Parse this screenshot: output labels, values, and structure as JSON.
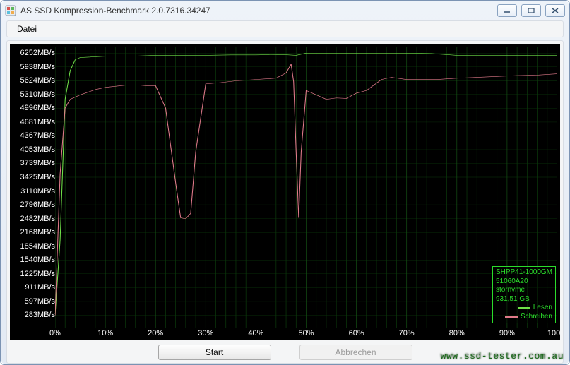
{
  "window": {
    "title": "AS SSD Kompression-Benchmark 2.0.7316.34247",
    "minimize_tip": "Minimize",
    "maximize_tip": "Maximize",
    "close_tip": "Close"
  },
  "menu": {
    "file": "Datei"
  },
  "buttons": {
    "start": "Start",
    "abort": "Abbrechen"
  },
  "legend": {
    "device_model": "SHPP41-1000GM",
    "firmware": "51060A20",
    "driver": "stornvme",
    "capacity": "931,51 GB",
    "read_label": "Lesen",
    "write_label": "Schreiben"
  },
  "watermark": "www.ssd-tester.com.au",
  "chart_data": {
    "type": "line",
    "title": "",
    "xlabel": "",
    "ylabel": "",
    "x_unit": "%",
    "y_unit": "MB/s",
    "xlim": [
      0,
      100
    ],
    "ylim": [
      0,
      6400
    ],
    "y_ticks": [
      283,
      597,
      911,
      1225,
      1540,
      1854,
      2168,
      2482,
      2796,
      3110,
      3425,
      3739,
      4053,
      4367,
      4681,
      4996,
      5310,
      5624,
      5938,
      6252
    ],
    "y_tick_labels": [
      "283MB/s",
      "597MB/s",
      "911MB/s",
      "1225MB/s",
      "1540MB/s",
      "1854MB/s",
      "2168MB/s",
      "2482MB/s",
      "2796MB/s",
      "3110MB/s",
      "3425MB/s",
      "3739MB/s",
      "4053MB/s",
      "4367MB/s",
      "4681MB/s",
      "4996MB/s",
      "5310MB/s",
      "5624MB/s",
      "5938MB/s",
      "6252MB/s"
    ],
    "x_ticks": [
      0,
      10,
      20,
      30,
      40,
      50,
      60,
      70,
      80,
      90,
      100
    ],
    "x_tick_labels": [
      "0%",
      "10%",
      "20%",
      "30%",
      "40%",
      "50%",
      "60%",
      "70%",
      "80%",
      "90%",
      "100%"
    ],
    "series": [
      {
        "name": "Lesen",
        "color": "#6fe048",
        "x": [
          0,
          1,
          2,
          3,
          4,
          5,
          10,
          15,
          20,
          25,
          30,
          35,
          40,
          45,
          48,
          50,
          55,
          60,
          65,
          70,
          75,
          80,
          85,
          90,
          95,
          100
        ],
        "y": [
          280,
          2000,
          5200,
          5850,
          6100,
          6150,
          6180,
          6180,
          6200,
          6200,
          6200,
          6210,
          6210,
          6220,
          6200,
          6250,
          6250,
          6250,
          6250,
          6250,
          6240,
          6200,
          6200,
          6200,
          6200,
          6200
        ]
      },
      {
        "name": "Schreiben",
        "color": "#e07a8a",
        "x": [
          0,
          1,
          2,
          3,
          5,
          8,
          10,
          14,
          17,
          18,
          20,
          22,
          24,
          25,
          26,
          27,
          28,
          30,
          33,
          36,
          40,
          44,
          46,
          47,
          47.5,
          48,
          48.5,
          49,
          50,
          52,
          54,
          56,
          58,
          60,
          62,
          65,
          67,
          70,
          73,
          76,
          80,
          84,
          88,
          92,
          96,
          100
        ],
        "y": [
          280,
          3500,
          5000,
          5200,
          5300,
          5420,
          5470,
          5520,
          5520,
          5510,
          5510,
          5000,
          3300,
          2500,
          2480,
          2600,
          4000,
          5550,
          5580,
          5620,
          5650,
          5680,
          5800,
          6000,
          5600,
          4000,
          2500,
          4000,
          5400,
          5300,
          5200,
          5230,
          5220,
          5340,
          5400,
          5650,
          5700,
          5650,
          5650,
          5650,
          5680,
          5700,
          5720,
          5740,
          5750,
          5780
        ]
      }
    ]
  }
}
